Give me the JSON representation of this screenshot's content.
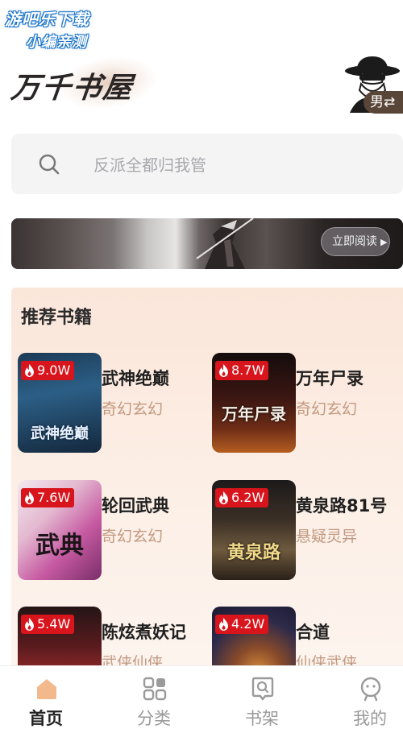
{
  "watermark": {
    "line1": "游吧乐下载",
    "line2": "小编亲测"
  },
  "header": {
    "logo_text": "万千书屋",
    "gender_label": "男⇄"
  },
  "search": {
    "placeholder": "反派全都归我管"
  },
  "banner": {
    "read_label": "立即阅读"
  },
  "recommend": {
    "title": "推荐书籍",
    "books": [
      {
        "name": "武神绝巅",
        "genre": "奇幻玄幻",
        "heat": "9.0W",
        "cover_title": "武神绝巅"
      },
      {
        "name": "万年尸录",
        "genre": "奇幻玄幻",
        "heat": "8.7W",
        "cover_title": "万年尸录"
      },
      {
        "name": "轮回武典",
        "genre": "奇幻玄幻",
        "heat": "7.6W",
        "cover_title": "武典"
      },
      {
        "name": "黄泉路81号",
        "genre": "悬疑灵异",
        "heat": "6.2W",
        "cover_title": "黄泉路"
      },
      {
        "name": "陈炫煮妖记",
        "genre": "武侠仙侠",
        "heat": "5.4W",
        "cover_title": ""
      },
      {
        "name": "合道",
        "genre": "仙侠武侠",
        "heat": "4.2W",
        "cover_title": ""
      }
    ]
  },
  "tabbar": {
    "items": [
      {
        "label": "首页",
        "icon": "home-icon",
        "active": true
      },
      {
        "label": "分类",
        "icon": "category-grid-icon",
        "active": false
      },
      {
        "label": "书架",
        "icon": "bookshelf-icon",
        "active": false
      },
      {
        "label": "我的",
        "icon": "profile-icon",
        "active": false
      }
    ]
  },
  "colors": {
    "accent": "#f2b98c",
    "heat_badge": "#d8141c",
    "genre": "#c29a82",
    "rec_bg": "#fbe6da"
  }
}
